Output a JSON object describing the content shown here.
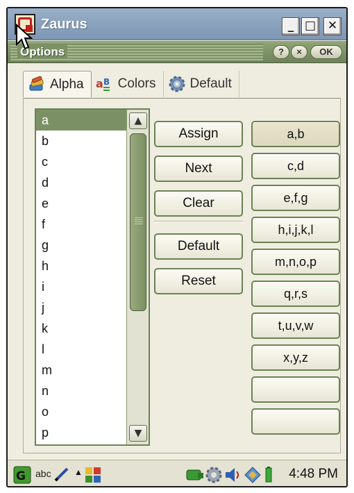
{
  "window": {
    "title": "Zaurus",
    "minimize": "_",
    "maximize": "□",
    "close": "✕"
  },
  "dialog": {
    "title": "Options",
    "help": "?",
    "close": "×",
    "ok": "OK"
  },
  "tabs": [
    {
      "label": "Alpha",
      "icon": "books-icon",
      "active": true
    },
    {
      "label": "Colors",
      "icon": "colors-icon",
      "active": false
    },
    {
      "label": "Default",
      "icon": "gear-icon",
      "active": false
    }
  ],
  "letters": [
    "a",
    "b",
    "c",
    "d",
    "e",
    "f",
    "g",
    "h",
    "i",
    "j",
    "k",
    "l",
    "m",
    "n",
    "o",
    "p"
  ],
  "selected_letter": "a",
  "scroll": {
    "up": "▲",
    "down": "▼"
  },
  "actions": {
    "assign": "Assign",
    "next": "Next",
    "clear": "Clear",
    "default": "Default",
    "reset": "Reset"
  },
  "groups": [
    "a,b",
    "c,d",
    "e,f,g",
    "h,i,j,k,l",
    "m,n,o,p",
    "q,r,s",
    "t,u,v,w",
    "x,y,z",
    "",
    ""
  ],
  "taskbar": {
    "input_method": "abc",
    "arrow": "▲",
    "clock": "4:48 PM"
  },
  "colors": {
    "accent": "#7b9165",
    "titlebar": "#8aa2bd",
    "background": "#efede0"
  }
}
